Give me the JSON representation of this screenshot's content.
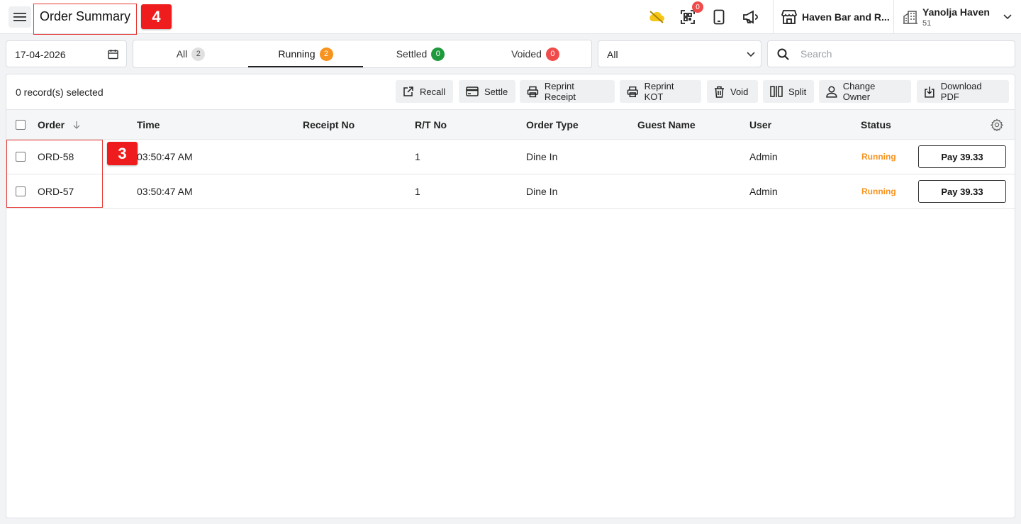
{
  "header": {
    "title": "Order Summary",
    "marker_title": "4",
    "notification_count": "0",
    "store_name": "Haven Bar and R...",
    "property_name": "Yanolja Haven",
    "property_id": "51",
    "icons": [
      "menu-icon",
      "cloud-off-icon",
      "qr-scan-icon",
      "tablet-icon",
      "megaphone-icon",
      "store-icon",
      "building-icon",
      "chevron-down-icon"
    ]
  },
  "filters": {
    "date": "17-04-2026",
    "tabs": [
      {
        "label": "All",
        "count": "2"
      },
      {
        "label": "Running",
        "count": "2"
      },
      {
        "label": "Settled",
        "count": "0"
      },
      {
        "label": "Voided",
        "count": "0"
      }
    ],
    "active_tab": "Running",
    "select_value": "All",
    "search_placeholder": "Search"
  },
  "toolbar": {
    "records_selected": "0 record(s) selected",
    "actions": [
      "Recall",
      "Settle",
      "Reprint Receipt",
      "Reprint KOT",
      "Void",
      "Split",
      "Change Owner",
      "Download PDF"
    ]
  },
  "table": {
    "columns": [
      "Order",
      "Time",
      "Receipt No",
      "R/T No",
      "Order Type",
      "Guest Name",
      "User",
      "Status"
    ],
    "rows": [
      {
        "order": "ORD-58",
        "time": "03:50:47 AM",
        "receipt_no": "",
        "rt_no": "1",
        "order_type": "Dine In",
        "guest_name": "",
        "user": "Admin",
        "status": "Running",
        "pay": "Pay 39.33"
      },
      {
        "order": "ORD-57",
        "time": "03:50:47 AM",
        "receipt_no": "",
        "rt_no": "1",
        "order_type": "Dine In",
        "guest_name": "",
        "user": "Admin",
        "status": "Running",
        "pay": "Pay 39.33"
      }
    ],
    "marker_rows": "3"
  },
  "colors": {
    "running": "#f7931e",
    "settled": "#1e9a3c",
    "voided": "#f04b4b",
    "annotation": "#ee1c1c"
  }
}
